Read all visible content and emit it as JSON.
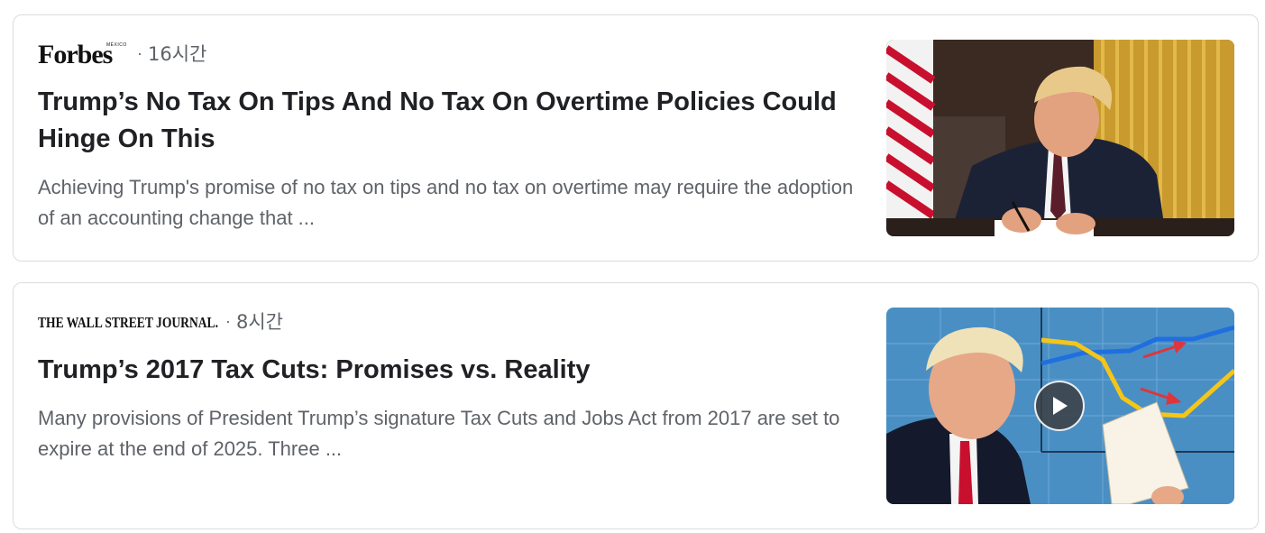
{
  "articles": [
    {
      "source": {
        "name": "Forbes",
        "sub": "MÉXICO",
        "logo_icon": "forbes-logo"
      },
      "separator": "·",
      "time": "16시간",
      "headline": "Trump’s No Tax On Tips And No Tax On Overtime Policies Could Hinge On This",
      "snippet": "Achieving Trump's promise of no tax on tips and no tax on overtime may require the adoption of an accounting change that ...",
      "thumbnail": {
        "has_video": false
      }
    },
    {
      "source": {
        "name": "THE WALL STREET JOURNAL.",
        "logo_icon": "wsj-logo"
      },
      "separator": "·",
      "time": "8시간",
      "headline": "Trump’s 2017 Tax Cuts: Promises vs. Reality",
      "snippet": "Many provisions of President Trump’s signature Tax Cuts and Jobs Act from 2017 are set to expire at the end of 2025. Three ...",
      "thumbnail": {
        "has_video": true,
        "play_icon": "play-icon"
      }
    }
  ],
  "colors": {
    "headline": "#202124",
    "secondary": "#5f6368",
    "border": "#dadce0"
  }
}
